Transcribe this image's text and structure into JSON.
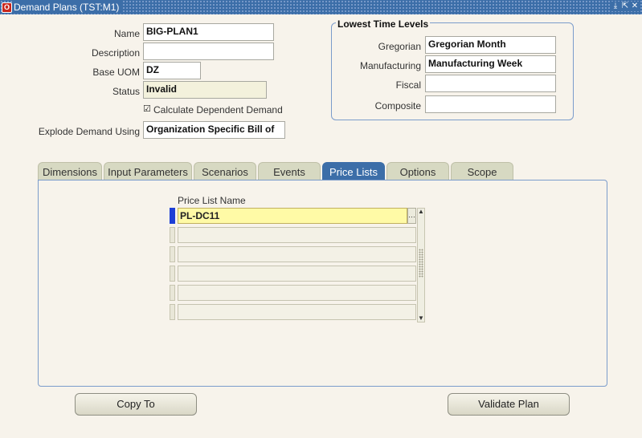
{
  "window": {
    "title": "Demand Plans (TST:M1)",
    "icon": "oracle-icon"
  },
  "form": {
    "name_label": "Name",
    "name_value": "BIG-PLAN1",
    "description_label": "Description",
    "description_value": "",
    "uom_label": "Base UOM",
    "uom_value": "DZ",
    "status_label": "Status",
    "status_value": "Invalid",
    "calc_dep_label": "Calculate Dependent Demand",
    "calc_dep_checked": true,
    "explode_label": "Explode Demand Using",
    "explode_value": "Organization Specific Bill of"
  },
  "time_levels": {
    "title": "Lowest Time Levels",
    "gregorian_label": "Gregorian",
    "gregorian_value": "Gregorian Month",
    "manufacturing_label": "Manufacturing",
    "manufacturing_value": "Manufacturing Week",
    "fiscal_label": "Fiscal",
    "fiscal_value": "",
    "composite_label": "Composite",
    "composite_value": ""
  },
  "tabs": [
    {
      "label": "Dimensions"
    },
    {
      "label": "Input Parameters"
    },
    {
      "label": "Scenarios"
    },
    {
      "label": "Events"
    },
    {
      "label": "Price Lists",
      "active": true
    },
    {
      "label": "Options"
    },
    {
      "label": "Scope"
    }
  ],
  "price_lists": {
    "column_header": "Price List Name",
    "rows": [
      "PL-DC11",
      "",
      "",
      "",
      "",
      ""
    ]
  },
  "buttons": {
    "copy": "Copy To",
    "validate": "Validate Plan"
  },
  "colors": {
    "title_bar": "#3c6ea8",
    "active_tab": "#3c6ea8",
    "current_row": "#fffaa6",
    "record_indicator": "#1d3fd6"
  }
}
